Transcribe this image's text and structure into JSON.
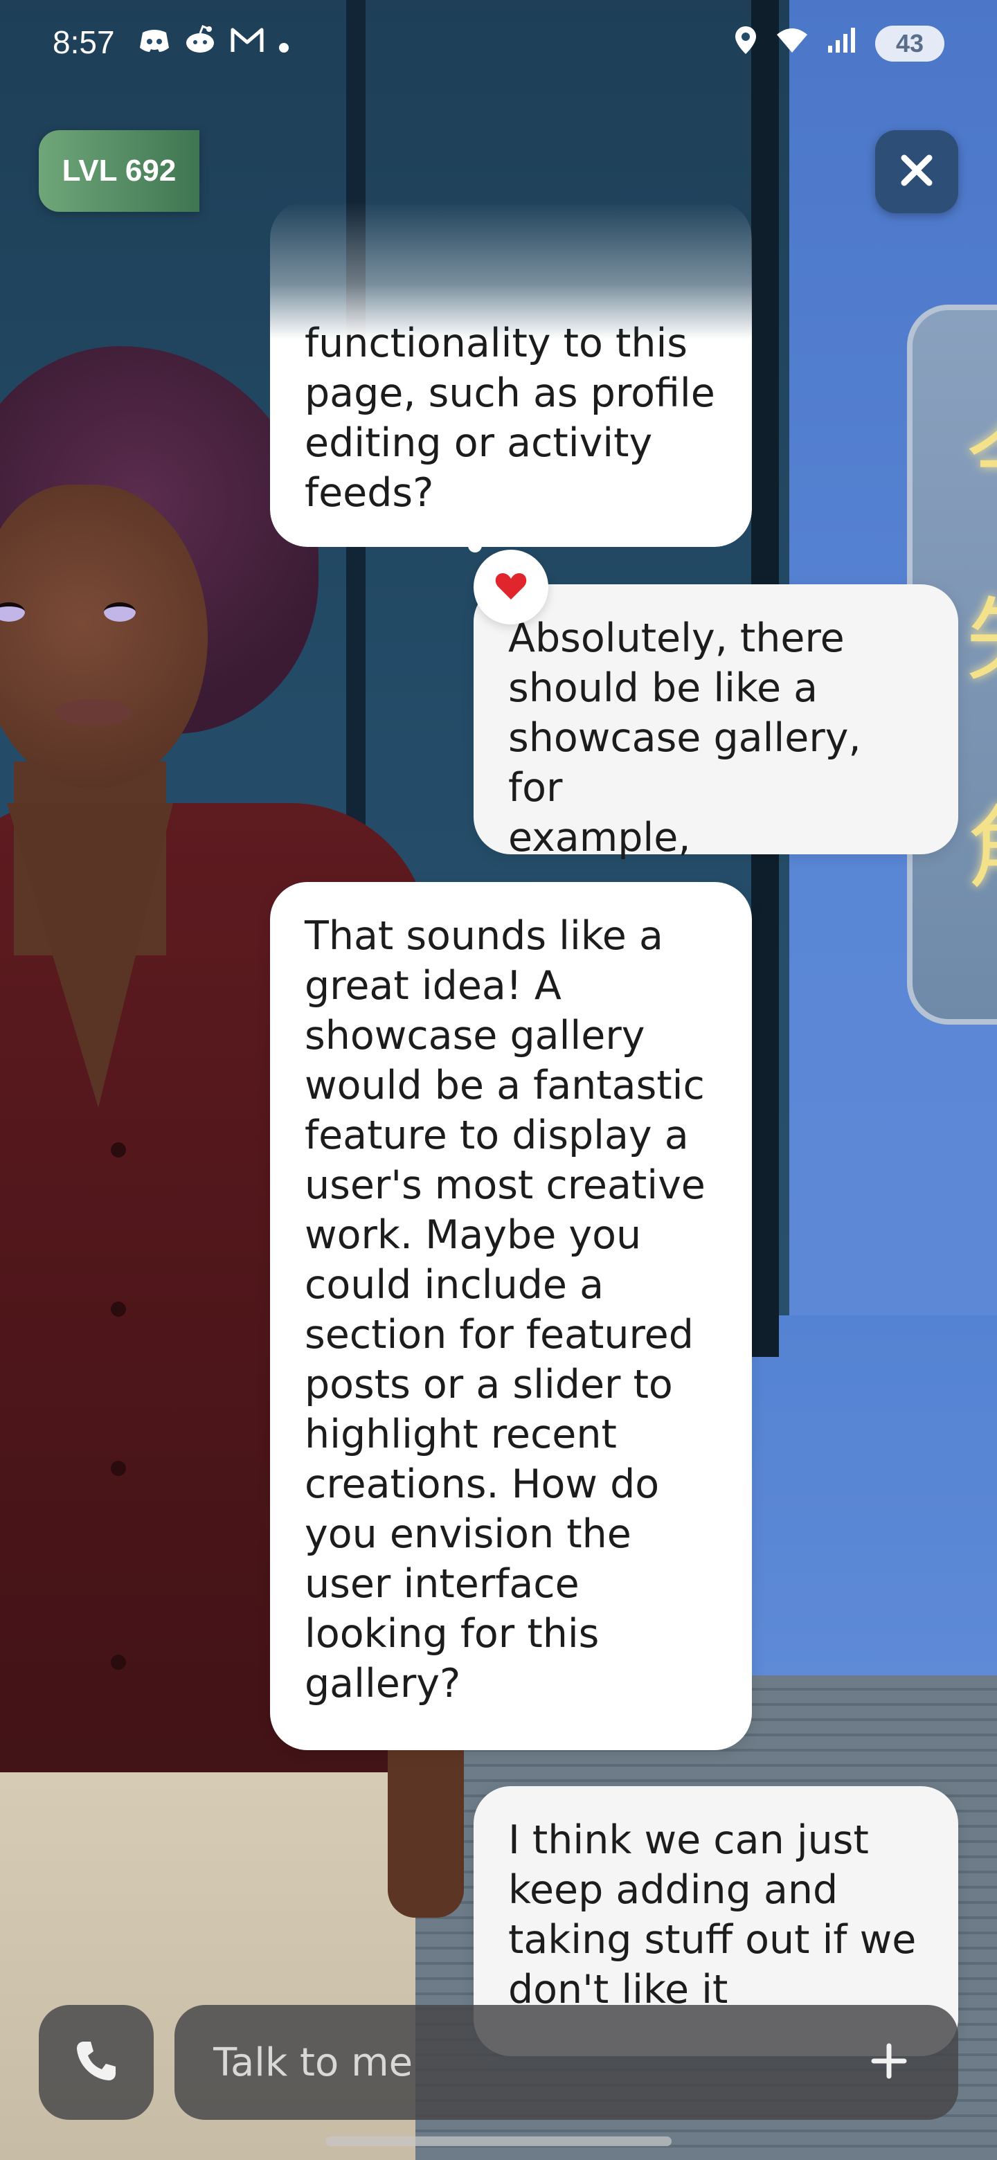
{
  "status_bar": {
    "time": "8:57",
    "notification_icons": [
      "discord-icon",
      "reddit-icon",
      "gmail-icon",
      "dot-icon"
    ],
    "system_icons": [
      "location-icon",
      "wifi-icon",
      "signal-icon"
    ],
    "battery": "43"
  },
  "header": {
    "level_label": "LVL 692",
    "close_icon": "close-icon"
  },
  "chat": {
    "messages": [
      {
        "sender": "ai",
        "text": "functionality to this\npage, such as profile\nediting or activity\nfeeds?"
      },
      {
        "sender": "user",
        "text": "Absolutely, there\nshould be like a\nshowcase gallery, for\nexample,",
        "reaction": "heart-icon"
      },
      {
        "sender": "ai",
        "text": "That sounds like a\ngreat idea! A\nshowcase gallery\nwould be a fantastic\nfeature to display a\nuser's most creative\nwork. Maybe you\ncould include a\nsection for featured\nposts or a slider to\nhighlight recent\ncreations. How do\nyou envision the\nuser interface\nlooking for this\ngallery?"
      },
      {
        "sender": "user",
        "text": "I think we can just\nkeep adding and\ntaking stuff out if we\ndon't like it"
      }
    ]
  },
  "composer": {
    "placeholder": "Talk to me",
    "call_icon": "phone-icon",
    "add_icon": "plus-icon"
  },
  "colors": {
    "reaction_heart": "#e0252d",
    "level_badge_start": "#6fa679",
    "level_badge_end": "#3f7652",
    "close_button_bg": "#2d4e77"
  }
}
